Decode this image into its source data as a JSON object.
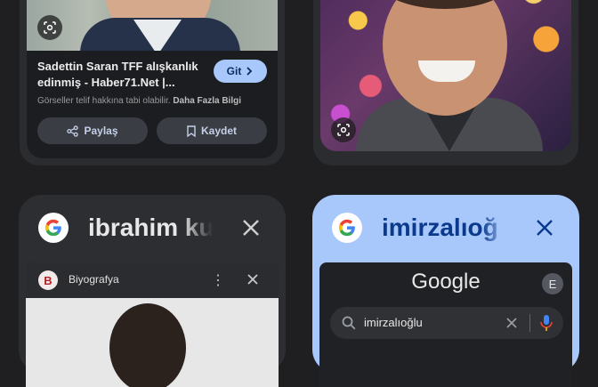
{
  "top_left_card": {
    "title": "Sadettin Saran TFF alışkanlık edinmiş - Haber71.Net |...",
    "go_label": "Git",
    "copyright_text": "Görseller telif hakkına tabi olabilir.",
    "more_info_link": "Daha Fazla Bilgi",
    "share_label": "Paylaş",
    "save_label": "Kaydet"
  },
  "tab_left": {
    "title": "ibrahim ku",
    "preview_label": "Biyografya",
    "site_icon_letter": "B"
  },
  "tab_right": {
    "title": "imirzalıoğ",
    "google_word": "Google",
    "avatar_letter": "E",
    "search_query": "imirzalıoğlu"
  },
  "colors": {
    "background": "#1f1f21",
    "card_dark": "#2d2e32",
    "active_tab": "#a8c7fa",
    "accent_button": "#a8c7fa"
  }
}
